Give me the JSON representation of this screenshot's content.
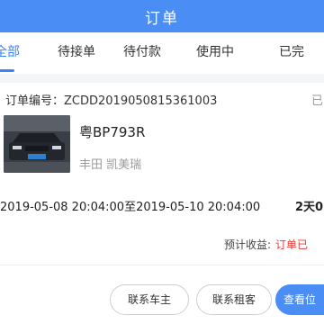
{
  "header": {
    "title": "订单"
  },
  "tabs": [
    {
      "label": "全部"
    },
    {
      "label": "待接单"
    },
    {
      "label": "待付款"
    },
    {
      "label": "使用中"
    },
    {
      "label": "已完"
    }
  ],
  "order": {
    "number_label": "订单编号：",
    "number": "ZCDD2019050815361003",
    "status": "已",
    "plate": "粤BP793R",
    "model": "丰田 凯美瑞",
    "rent_range": "2019-05-08 20:04:00至2019-05-10 20:04:00",
    "rent_days": "2天0",
    "income_label": "预计收益:",
    "income_value": "订单已"
  },
  "actions": {
    "contact_owner": "联系车主",
    "contact_renter": "联系租客",
    "view_location": "查看位"
  },
  "colors": {
    "primary": "#4a8ef5",
    "income": "#e53935"
  }
}
